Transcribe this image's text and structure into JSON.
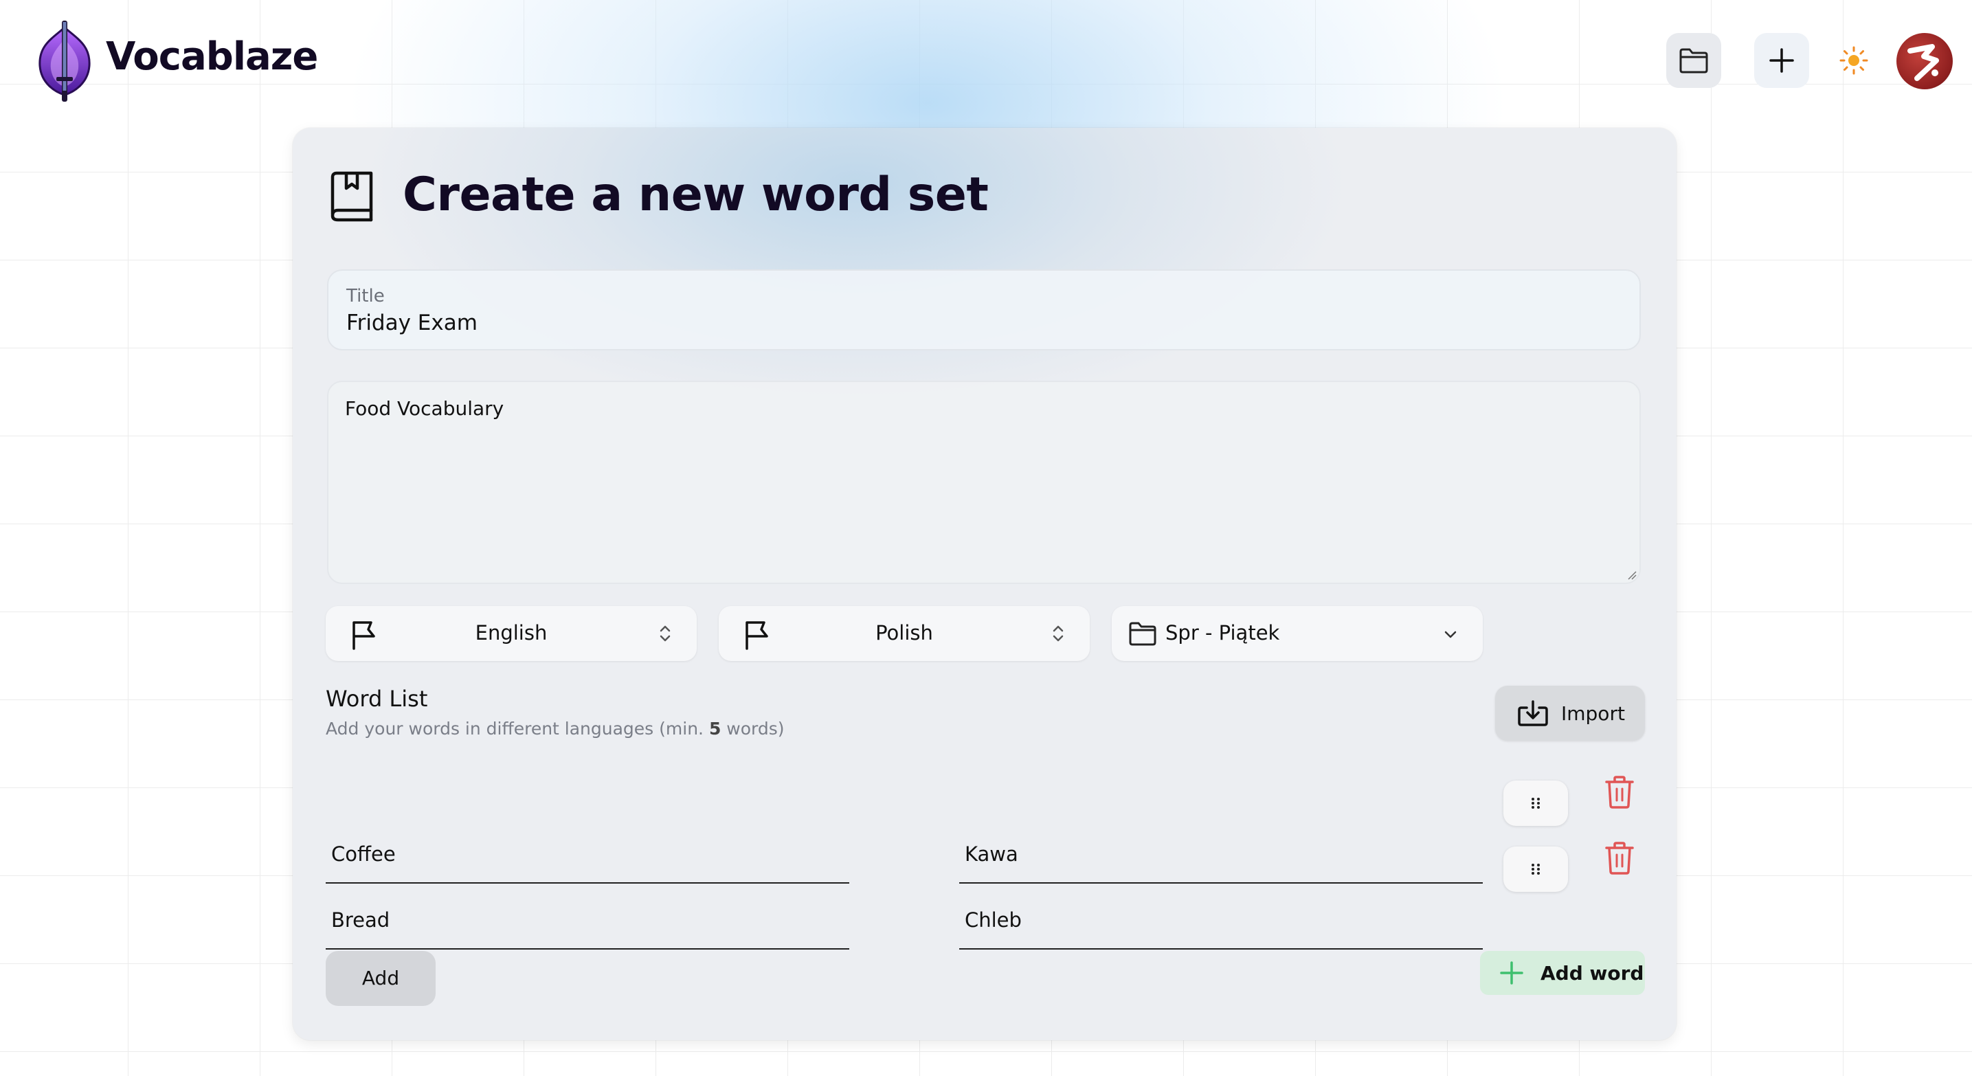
{
  "app": {
    "name": "Vocablaze"
  },
  "header": {
    "buttons": [
      "folder-icon",
      "plus-icon",
      "sun-icon",
      "avatar"
    ]
  },
  "form": {
    "heading": "Create a new word set",
    "title_label": "Title",
    "title_value": "Friday Exam",
    "description_value": "Food Vocabulary",
    "source_language": "English",
    "target_language": "Polish",
    "folder": "Spr - Piątek"
  },
  "word_list": {
    "heading": "Word List",
    "subtitle_pre": "Add your words in different languages (min. ",
    "min_words": "5",
    "subtitle_post": " words)",
    "import_label": "Import",
    "rows": [
      {
        "source": "Coffee",
        "target": "Kawa"
      },
      {
        "source": "Bread",
        "target": "Chleb"
      }
    ],
    "add_label": "Add",
    "add_word_label": "Add word"
  },
  "colors": {
    "accent_green": "#3fbf6e",
    "delete_red": "#e05555",
    "brand_purple": "#7b2fd6"
  }
}
